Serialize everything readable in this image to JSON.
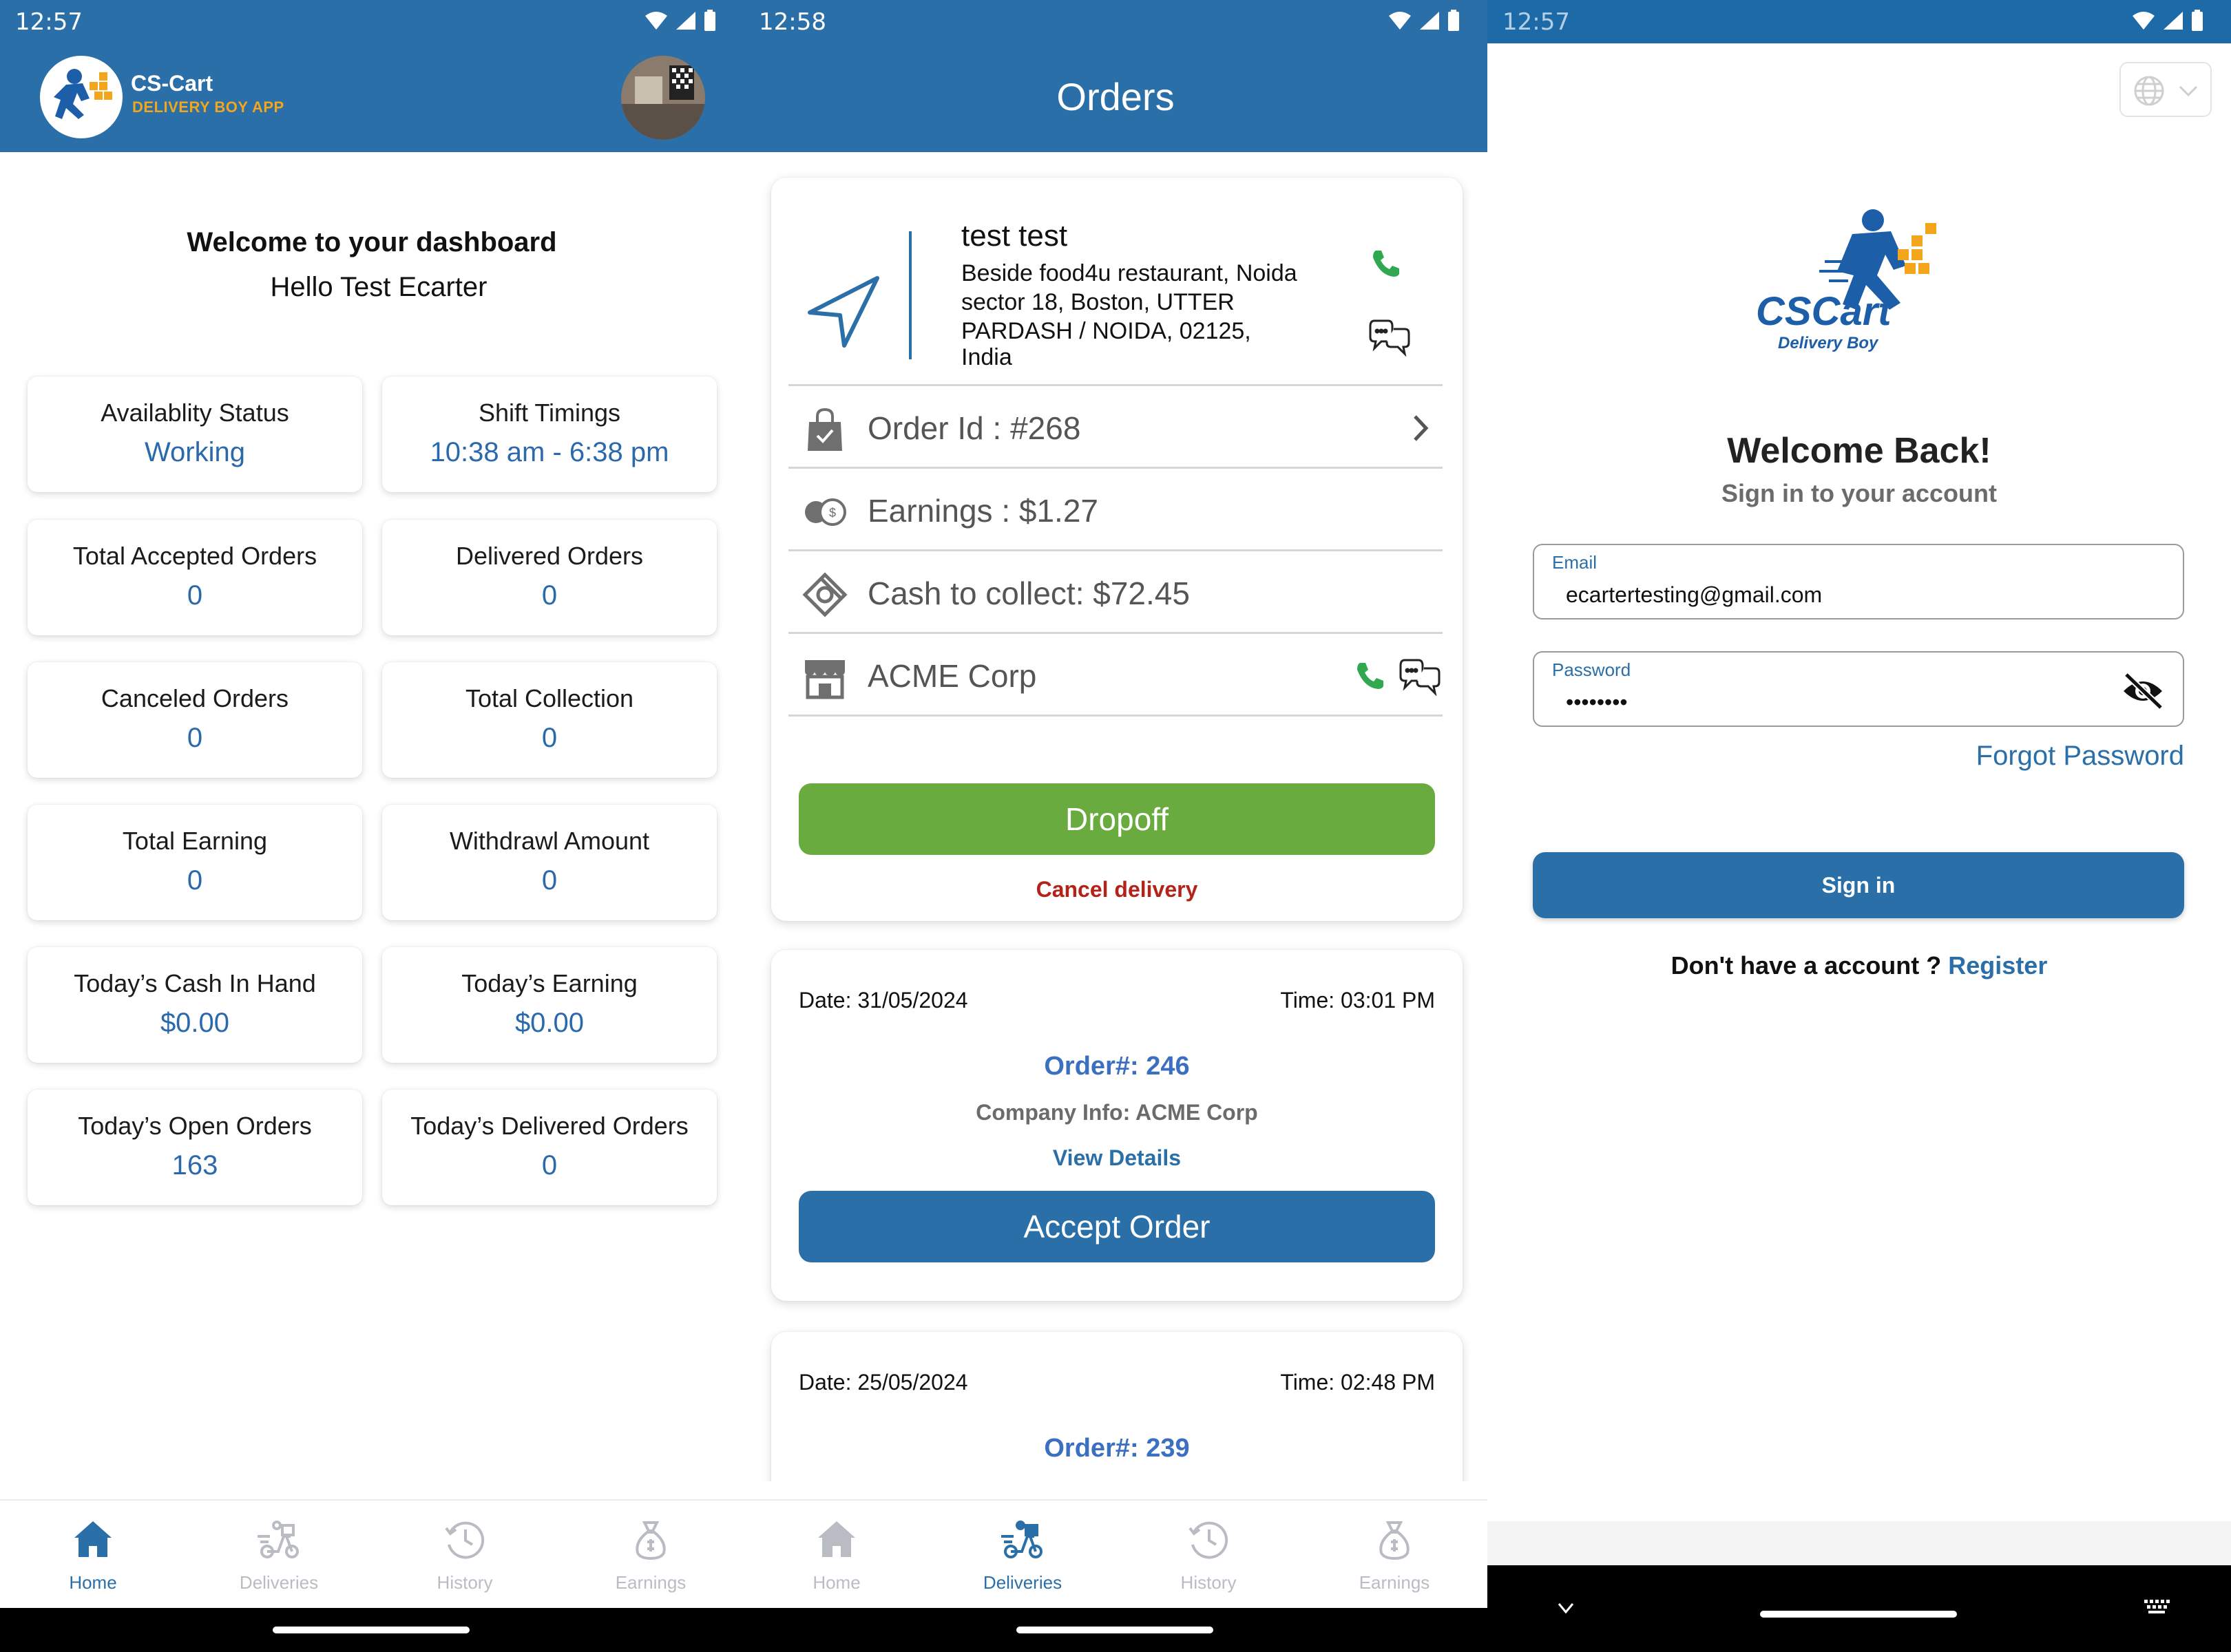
{
  "screen1": {
    "status": {
      "time": "12:57"
    },
    "brand": {
      "title": "CS-Cart",
      "subtitle": "DELIVERY BOY APP"
    },
    "welcome": {
      "title": "Welcome to your dashboard",
      "greeting": "Hello Test Ecarter"
    },
    "cards": [
      {
        "label": "Availablity Status",
        "value": "Working"
      },
      {
        "label": "Shift Timings",
        "value": "10:38 am - 6:38 pm"
      },
      {
        "label": "Total Accepted Orders",
        "value": "0"
      },
      {
        "label": "Delivered Orders",
        "value": "0"
      },
      {
        "label": "Canceled Orders",
        "value": "0"
      },
      {
        "label": "Total Collection",
        "value": "0"
      },
      {
        "label": "Total Earning",
        "value": "0"
      },
      {
        "label": "Withdrawl Amount",
        "value": "0"
      },
      {
        "label": "Today’s Cash In Hand",
        "value": "$0.00"
      },
      {
        "label": "Today’s Earning",
        "value": "$0.00"
      },
      {
        "label": "Today’s Open Orders",
        "value": "163"
      },
      {
        "label": "Today’s Delivered Orders",
        "value": "0"
      }
    ],
    "nav": [
      {
        "label": "Home",
        "icon": "home-icon",
        "active": true
      },
      {
        "label": "Deliveries",
        "icon": "delivery-scooter-icon",
        "active": false
      },
      {
        "label": "History",
        "icon": "history-clock-icon",
        "active": false
      },
      {
        "label": "Earnings",
        "icon": "money-bag-icon",
        "active": false
      }
    ]
  },
  "screen2": {
    "status": {
      "time": "12:58"
    },
    "title": "Orders",
    "current_order": {
      "customer_name": "test test",
      "address": "Beside food4u restaurant,  Noida sector 18,  Boston,  UTTER PARDASH / NOIDA,  02125,",
      "country": "India",
      "order_id": "Order Id : #268",
      "earnings": "Earnings : $1.27",
      "cash_to_collect": "Cash to collect: $72.45",
      "company": "ACME Corp",
      "dropoff_label": "Dropoff",
      "cancel_label": "Cancel delivery"
    },
    "orders": [
      {
        "date": "Date: 31/05/2024",
        "time": "Time: 03:01 PM",
        "number": "Order#: 246",
        "company": "Company Info: ACME Corp",
        "view": "View Details",
        "accept": "Accept Order"
      },
      {
        "date": "Date: 25/05/2024",
        "time": "Time: 02:48 PM",
        "number": "Order#: 239"
      }
    ],
    "nav": [
      {
        "label": "Home",
        "icon": "home-icon",
        "active": false
      },
      {
        "label": "Deliveries",
        "icon": "delivery-scooter-icon",
        "active": true
      },
      {
        "label": "History",
        "icon": "history-clock-icon",
        "active": false
      },
      {
        "label": "Earnings",
        "icon": "money-bag-icon",
        "active": false
      }
    ]
  },
  "screen3": {
    "status": {
      "time": "12:57"
    },
    "logo": {
      "brand": "CSCart",
      "tagline": "Delivery Boy"
    },
    "title": "Welcome Back!",
    "subtitle": "Sign in to your account",
    "email": {
      "label": "Email",
      "value": "ecartertesting@gmail.com"
    },
    "password": {
      "label": "Password",
      "value": "••••••••"
    },
    "forgot_label": "Forgot Password",
    "signin_label": "Sign in",
    "register": {
      "prompt": "Don't have a account ?",
      "link": "Register"
    }
  },
  "colors": {
    "primary": "#2a6fa8",
    "accent_orange": "#f3a51b",
    "success_green": "#6aab3f",
    "danger_red": "#b42318",
    "link_blue": "#3b6fc2"
  }
}
